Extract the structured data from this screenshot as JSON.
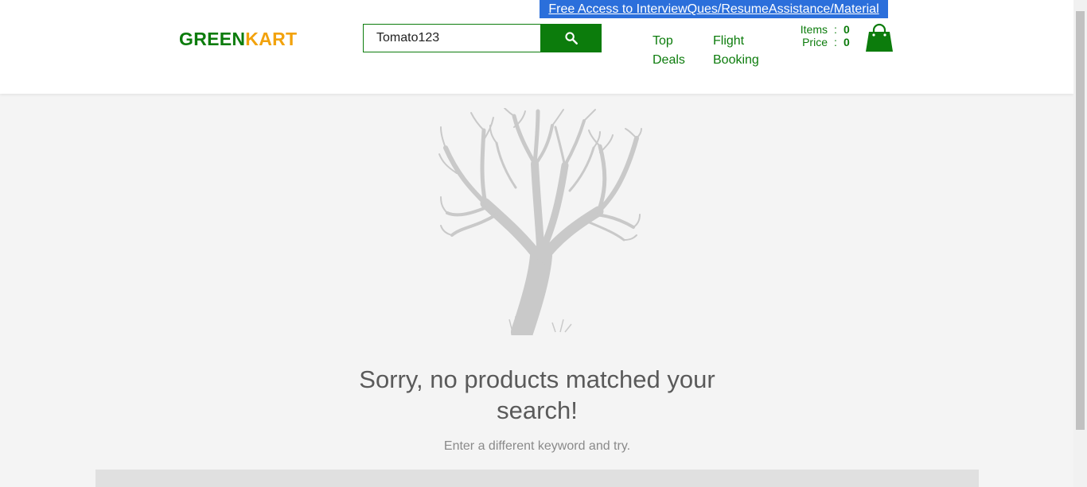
{
  "promo_banner": "Free Access to InterviewQues/ResumeAssistance/Material",
  "brand": {
    "part1": "GREEN",
    "part2": "KART",
    "color1": "#0c7c0c",
    "color2": "#f2a20c"
  },
  "search": {
    "value": "Tomato123",
    "icon": "search-icon"
  },
  "nav": [
    {
      "label": "Top\nDeals"
    },
    {
      "label": "Flight\nBooking"
    }
  ],
  "cart": {
    "items_label": "Items",
    "items_value": "0",
    "price_label": "Price",
    "price_value": "0",
    "separator": ":",
    "icon": "shopping-bag-icon"
  },
  "empty_state": {
    "illustration": "bare-tree-icon",
    "title": "Sorry, no products matched your search!",
    "hint": "Enter a different keyword and try."
  },
  "colors": {
    "accent": "#0c7c0c",
    "banner": "#2b6fdb",
    "background": "#f4f4f4"
  }
}
